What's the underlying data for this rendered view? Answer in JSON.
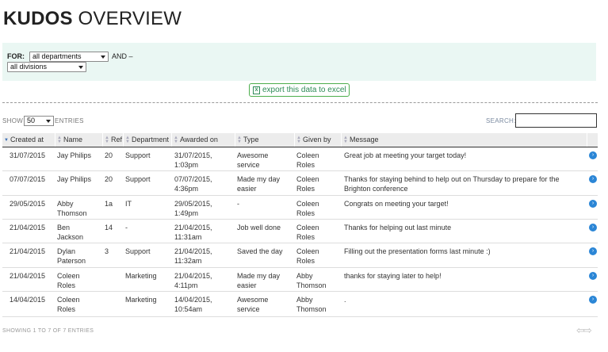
{
  "page": {
    "title_bold": "KUDOS",
    "title_rest": "OVERVIEW"
  },
  "filter": {
    "for_label": "FOR:",
    "department_value": "all departments",
    "and_label": "AND –",
    "division_value": "all divisions"
  },
  "export": {
    "label": "export this data to excel",
    "icon": "excel-icon"
  },
  "table_controls": {
    "show_label": "SHOW",
    "page_length": "50",
    "entries_label": "ENTRIES",
    "search_label": "SEARCH:",
    "search_value": ""
  },
  "columns": [
    "Created at",
    "Name",
    "Ref",
    "Department",
    "Awarded on",
    "Type",
    "Given by",
    "Message"
  ],
  "rows": [
    {
      "created": "31/07/2015",
      "name": [
        "Jay Philips"
      ],
      "ref": "20",
      "dept": "Support",
      "awarded": [
        "31/07/2015,",
        "1:03pm"
      ],
      "type": [
        "Awesome",
        "service"
      ],
      "given": [
        "Coleen",
        "Roles"
      ],
      "message": [
        "Great job at meeting your target today!"
      ]
    },
    {
      "created": "07/07/2015",
      "name": [
        "Jay Philips"
      ],
      "ref": "20",
      "dept": "Support",
      "awarded": [
        "07/07/2015,",
        "4:36pm"
      ],
      "type": [
        "Made my day",
        "easier"
      ],
      "given": [
        "Coleen",
        "Roles"
      ],
      "message": [
        "Thanks for staying behind to help out on Thursday to prepare for the",
        "Brighton conference"
      ]
    },
    {
      "created": "29/05/2015",
      "name": [
        "Abby",
        "Thomson"
      ],
      "ref": "1a",
      "dept": "IT",
      "awarded": [
        "29/05/2015,",
        "1:49pm"
      ],
      "type": [
        "-"
      ],
      "given": [
        "Coleen",
        "Roles"
      ],
      "message": [
        "Congrats on meeting your target!"
      ]
    },
    {
      "created": "21/04/2015",
      "name": [
        "Ben",
        "Jackson"
      ],
      "ref": "14",
      "dept": "-",
      "awarded": [
        "21/04/2015,",
        "11:31am"
      ],
      "type": [
        "Job well done"
      ],
      "given": [
        "Coleen",
        "Roles"
      ],
      "message": [
        "Thanks for helping out last minute"
      ]
    },
    {
      "created": "21/04/2015",
      "name": [
        "Dylan",
        "Paterson"
      ],
      "ref": "3",
      "dept": "Support",
      "awarded": [
        "21/04/2015,",
        "11:32am"
      ],
      "type": [
        "Saved the day"
      ],
      "given": [
        "Coleen",
        "Roles"
      ],
      "message": [
        "Filling out the presentation forms last minute :)"
      ]
    },
    {
      "created": "21/04/2015",
      "name": [
        "Coleen",
        "Roles"
      ],
      "ref": "",
      "dept": "Marketing",
      "awarded": [
        "21/04/2015,",
        "4:11pm"
      ],
      "type": [
        "Made my day",
        "easier"
      ],
      "given": [
        "Abby",
        "Thomson"
      ],
      "message": [
        "thanks for staying later to help!"
      ]
    },
    {
      "created": "14/04/2015",
      "name": [
        "Coleen",
        "Roles"
      ],
      "ref": "",
      "dept": "Marketing",
      "awarded": [
        "14/04/2015,",
        "10:54am"
      ],
      "type": [
        "Awesome",
        "service"
      ],
      "given": [
        "Abby",
        "Thomson"
      ],
      "message": [
        "."
      ]
    }
  ],
  "footer": {
    "info": "SHOWING 1 TO 7 OF 7 ENTRIES",
    "pager": "⇦⇨"
  }
}
